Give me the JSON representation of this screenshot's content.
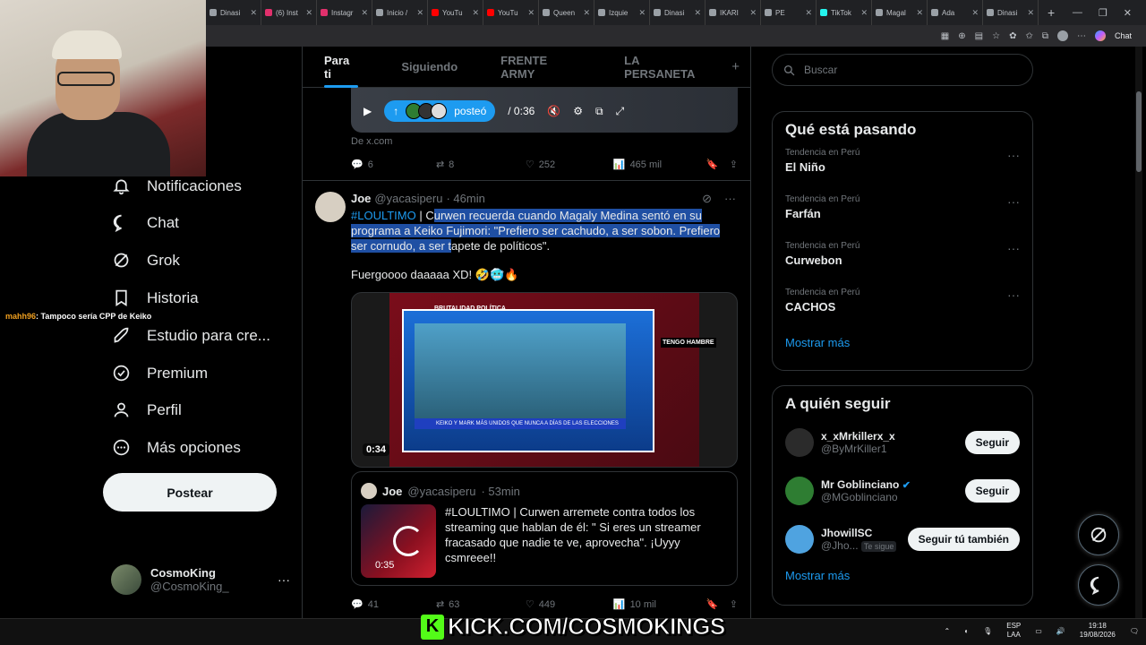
{
  "browser": {
    "tabs": [
      {
        "label": "Dinasi",
        "color": "#9aa0a6"
      },
      {
        "label": "(6) Inst",
        "color": "#e1306c"
      },
      {
        "label": "Instagr",
        "color": "#e1306c"
      },
      {
        "label": "Inicio /",
        "color": "#9aa0a6"
      },
      {
        "label": "YouTu",
        "color": "#ff0000"
      },
      {
        "label": "YouTu",
        "color": "#ff0000"
      },
      {
        "label": "Queen",
        "color": "#9aa0a6"
      },
      {
        "label": "Izquie",
        "color": "#9aa0a6"
      },
      {
        "label": "Dinasi",
        "color": "#9aa0a6"
      },
      {
        "label": "IKARI",
        "color": "#9aa0a6"
      },
      {
        "label": "PE",
        "color": "#9aa0a6"
      },
      {
        "label": "TikTok",
        "color": "#25f4ee"
      },
      {
        "label": "Magal",
        "color": "#9aa0a6"
      },
      {
        "label": "Ada",
        "color": "#9aa0a6"
      },
      {
        "label": "Dinasi",
        "color": "#9aa0a6"
      }
    ],
    "new_tab": "+",
    "chat_label": "Chat"
  },
  "stream_chat": {
    "user": "mahh96",
    "message": ": Tampoco sería CPP de Keiko"
  },
  "sidebar": {
    "items": [
      {
        "label": "Notificaciones",
        "icon": "bell-icon"
      },
      {
        "label": "Chat",
        "icon": "chat-icon"
      },
      {
        "label": "Grok",
        "icon": "grok-icon"
      },
      {
        "label": "Historia",
        "icon": "bookmark-icon"
      },
      {
        "label": "Estudio para cre...",
        "icon": "rocket-icon"
      },
      {
        "label": "Premium",
        "icon": "verified-icon"
      },
      {
        "label": "Perfil",
        "icon": "person-icon"
      },
      {
        "label": "Más opciones",
        "icon": "more-circle-icon"
      }
    ],
    "post_button": "Postear",
    "account": {
      "name": "CosmoKing",
      "handle": "@CosmoKing_"
    }
  },
  "feed": {
    "tabs": [
      "Para ti",
      "Siguiendo",
      "FRENTE ARMY",
      "LA PERSANETA"
    ],
    "tabs_plus": "+",
    "prev_tweet": {
      "video_time": "/ 0:36",
      "posted_label": "posteó",
      "from": "De x.com",
      "replies": "6",
      "retweets": "8",
      "likes": "252",
      "views": "465 mil"
    },
    "tweet": {
      "name": "Joe",
      "handle": "@yacasiperu",
      "time": "· 46min",
      "hashtag": "#LOULTIMO",
      "text_lead": " | C",
      "text_highlight": "urwen recuerda cuando Magaly Medina sentó en su programa a Keiko Fujimori: \"Prefiero ser cachudo, a ser sobon. Prefiero ser cornudo, a ser t",
      "text_tail": "apete de políticos\".",
      "text2": "Fuergoooo daaaaa XD! 🤣🥶🔥",
      "media_duration": "0:34",
      "media_tag": "BRUTALIDAD POLÍTICA",
      "media_side": "TENGO HAMBRE",
      "media_banner": "KEIKO Y MARK MÁS UNIDOS QUE NUNCA A DÍAS DE LAS ELECCIONES",
      "quote": {
        "name": "Joe",
        "handle": "@yacasiperu",
        "time": "· 53min",
        "text": "#LOULTIMO | Curwen arremete contra todos los streaming que hablan de él: \" Si eres un streamer fracasado que nadie te ve, aprovecha\". ¡Uyyy csmreee!!",
        "duration": "0:35"
      },
      "replies": "41",
      "retweets": "63",
      "likes": "449",
      "views": "10 mil"
    }
  },
  "right": {
    "search_placeholder": "Buscar",
    "trends_title": "Qué está pasando",
    "trends": [
      {
        "context": "Tendencia en Perú",
        "title": "El Niño"
      },
      {
        "context": "Tendencia en Perú",
        "title": "Farfán"
      },
      {
        "context": "Tendencia en Perú",
        "title": "Curwebon"
      },
      {
        "context": "Tendencia en Perú",
        "title": "CACHOS"
      }
    ],
    "show_more": "Mostrar más",
    "follow_title": "A quién seguir",
    "follow": [
      {
        "name": "x_xMrkillerx_x",
        "handle": "@ByMrKiller1",
        "button": "Seguir",
        "avatar": "#2b2b2b"
      },
      {
        "name": "Mr Goblinciano",
        "handle": "@MGoblinciano",
        "button": "Seguir",
        "avatar": "#2e7d32"
      },
      {
        "name": "JhowillSC",
        "handle": "@Jho...",
        "badge": "Te sigue",
        "button": "Seguir tú también",
        "avatar": "#4fa3e0"
      }
    ],
    "show_more2": "Mostrar más"
  },
  "overlay": {
    "kick_text": "KICK.COM/COSMOKINGS"
  },
  "taskbar": {
    "lang1": "ESP",
    "lang2": "LAA",
    "time": "19:18",
    "date": "19/08/2026"
  }
}
